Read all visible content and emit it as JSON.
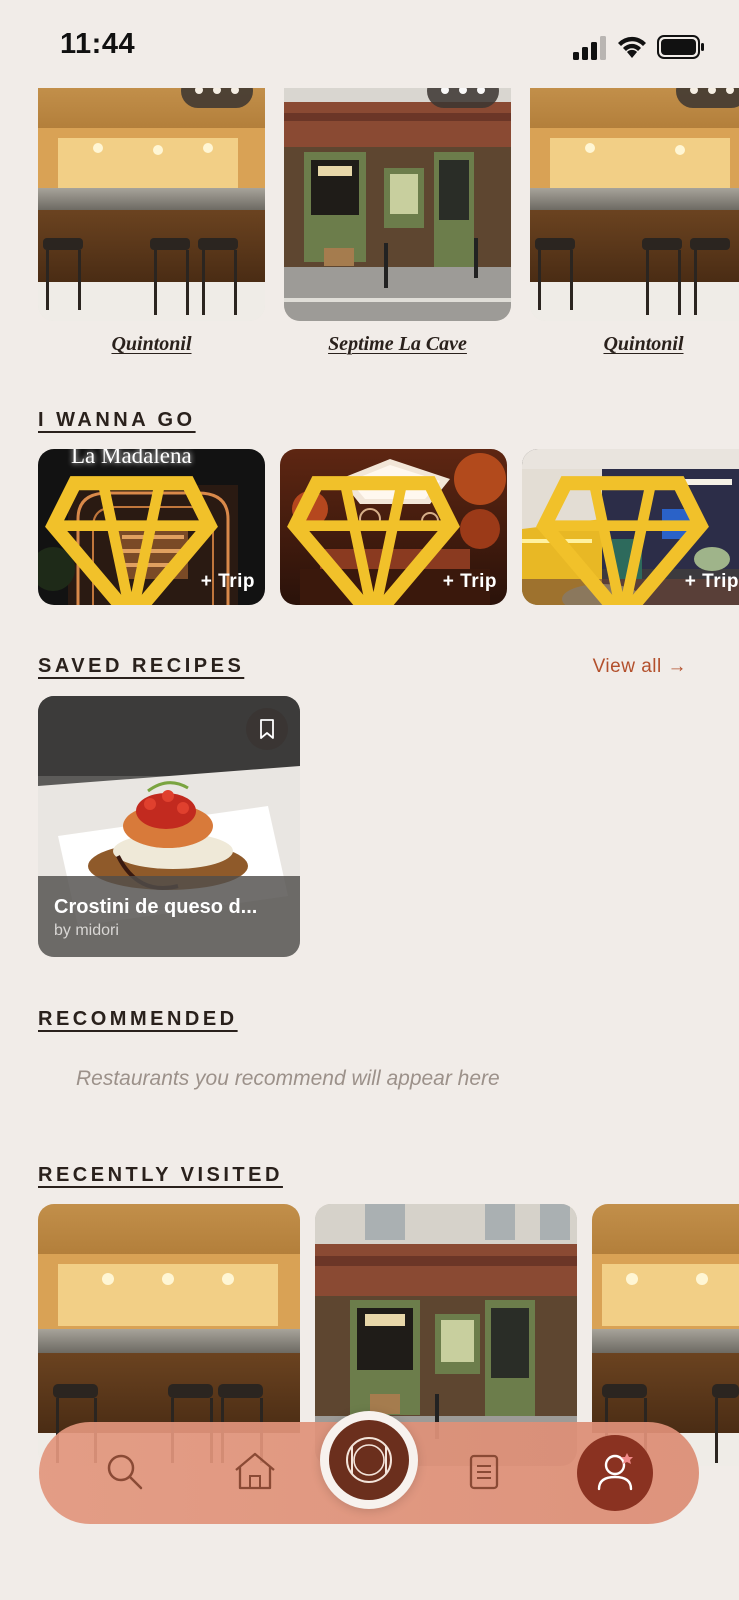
{
  "status_bar": {
    "time": "11:44",
    "signal_icon": "signal-icon",
    "wifi_icon": "wifi-icon",
    "battery_icon": "battery-icon"
  },
  "top_carousel": {
    "items": [
      {
        "name": "Quintonil",
        "image": "restaurant-bar-photo"
      },
      {
        "name": "Septime La Cave",
        "image": "restaurant-storefront-photo"
      },
      {
        "name": "Quintonil",
        "image": "restaurant-bar-photo"
      }
    ],
    "more_icon": "more-dots-icon"
  },
  "wanna_go": {
    "title": "I WANNA GO",
    "items": [
      {
        "trip_label": "+ Trip",
        "sign": "La Madalena",
        "badge_icon": "diamond-icon"
      },
      {
        "trip_label": "+ Trip",
        "badge_icon": "diamond-icon"
      },
      {
        "trip_label": "+ Trip",
        "badge_icon": "diamond-icon"
      }
    ]
  },
  "saved_recipes": {
    "title": "SAVED RECIPES",
    "view_all": "View all →",
    "items": [
      {
        "title": "Crostini de queso d...",
        "author": "by midori",
        "bookmark_icon": "bookmark-icon"
      }
    ]
  },
  "recommended": {
    "title": "RECOMMENDED",
    "empty_text": "Restaurants you recommend will appear here"
  },
  "recently_visited": {
    "title": "RECENTLY VISITED",
    "items": [
      "restaurant-bar-photo",
      "restaurant-storefront-photo",
      "restaurant-bar-photo"
    ]
  },
  "bottom_nav": {
    "items": [
      "search-icon",
      "home-icon",
      "plate-icon",
      "list-icon",
      "profile-icon"
    ],
    "colors": {
      "bar": "#e2967d",
      "center": "#6b2f1d",
      "profile": "#8a3221"
    }
  },
  "colors": {
    "background": "#f1ece8",
    "accent": "#b3502c"
  }
}
